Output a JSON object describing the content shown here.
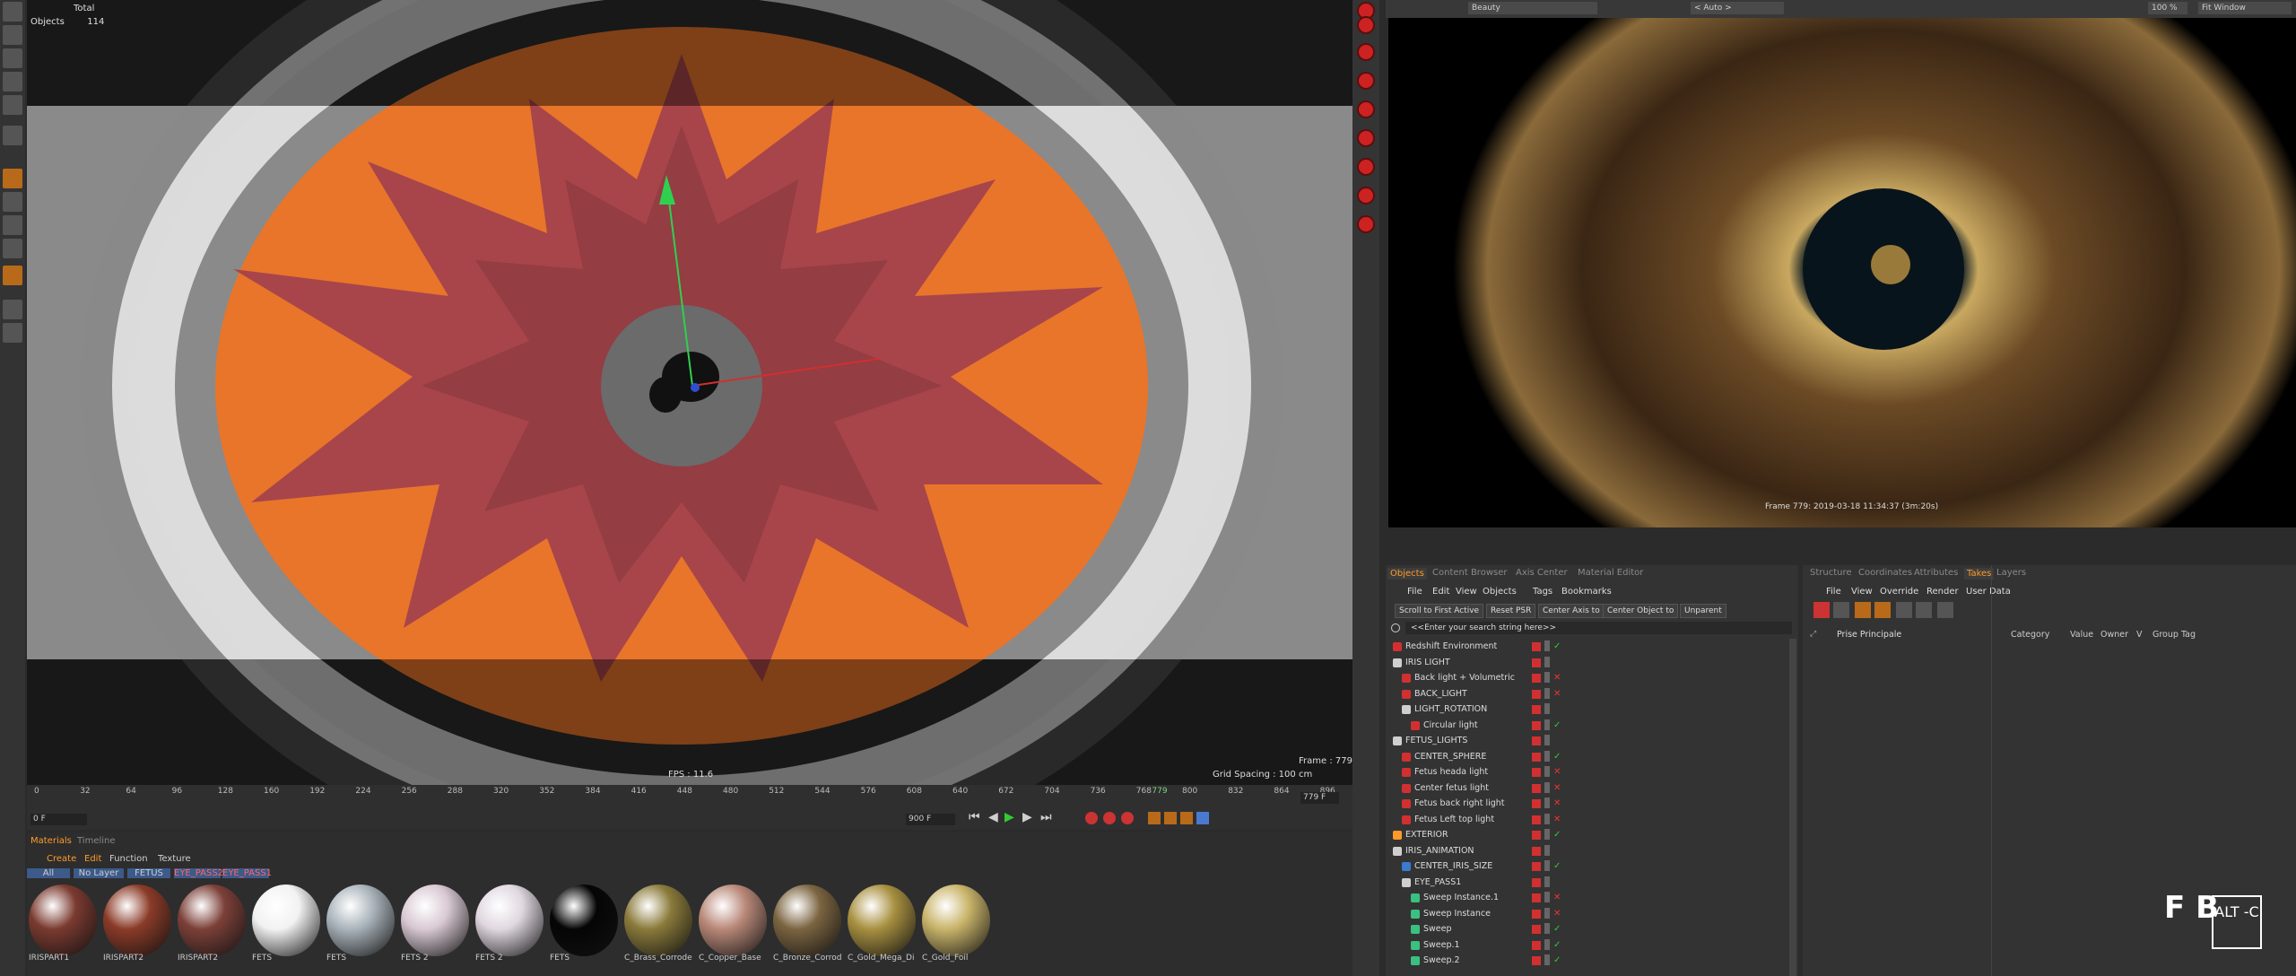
{
  "hud": {
    "total_label": "Total",
    "objects_label": "Objects",
    "objects_value": "114"
  },
  "viewport": {
    "fps": "FPS : 11.6",
    "grid": "Grid Spacing : 100 cm",
    "frame": "Frame : 779"
  },
  "timeline": {
    "ticks": [
      "0",
      "32",
      "64",
      "96",
      "128",
      "160",
      "192",
      "224",
      "256",
      "288",
      "320",
      "352",
      "384",
      "416",
      "448",
      "480",
      "512",
      "544",
      "576",
      "608",
      "640",
      "672",
      "704",
      "736",
      "768",
      "779",
      "800",
      "832",
      "864",
      "896"
    ],
    "start_field": "0 F",
    "end_field": "900 F",
    "current_field": "779 F"
  },
  "materials": {
    "tabs": [
      "Materials",
      "Timeline"
    ],
    "menu": [
      "Create",
      "Edit",
      "Function",
      "Texture"
    ],
    "filters": [
      "All",
      "No Layer",
      "FETUS",
      "EYE_PASS2",
      "EYE_PASS1"
    ],
    "items": [
      {
        "label": "IRISPART1",
        "color": "#7a3a30"
      },
      {
        "label": "IRISPART2",
        "color": "#8b3b28"
      },
      {
        "label": "IRISPART2",
        "color": "#7c4038"
      },
      {
        "label": "FETS",
        "color": "#f2f2f2"
      },
      {
        "label": "FETS",
        "color": "#aab4bb"
      },
      {
        "label": "FETS 2",
        "color": "#d9c9d3"
      },
      {
        "label": "FETS 2",
        "color": "#e0d8e0"
      },
      {
        "label": "FETS",
        "color": "#050505"
      },
      {
        "label": "C_Brass_Corrode",
        "color": "#8a7a3a"
      },
      {
        "label": "C_Copper_Base",
        "color": "#b88878"
      },
      {
        "label": "C_Bronze_Corrod",
        "color": "#7b6440"
      },
      {
        "label": "C_Gold_Mega_Di",
        "color": "#a89040"
      },
      {
        "label": "C_Gold_Foil",
        "color": "#c9b46a"
      }
    ]
  },
  "render_toolbar": {
    "mode": "Beauty",
    "camera": "< Auto >",
    "zoom": "100 %",
    "fit": "Fit Window"
  },
  "render_caption": "Frame  779:  2019-03-18  11:34:37  (3m:20s)",
  "objects_panel": {
    "tabs": [
      "Objects",
      "Content Browser",
      "Axis Center",
      "Material Editor"
    ],
    "menu": [
      "File",
      "Edit",
      "View",
      "Objects",
      "Tags",
      "Bookmarks"
    ],
    "buttons": [
      "Scroll to First Active",
      "Reset PSR",
      "Center Axis to",
      "Center Object to",
      "Unparent"
    ],
    "search": "<<Enter your search string here>>",
    "rows": [
      {
        "name": "Redshift Environment",
        "indent": 0,
        "color": "#d23030",
        "check": "✓"
      },
      {
        "name": "IRIS LIGHT",
        "indent": 0,
        "color": "#cfcfcf",
        "check": ""
      },
      {
        "name": "Back light + Volumetric",
        "indent": 1,
        "color": "#d23030",
        "check": "✕"
      },
      {
        "name": "BACK_LIGHT",
        "indent": 1,
        "color": "#d23030",
        "check": "✕"
      },
      {
        "name": "LIGHT_ROTATION",
        "indent": 1,
        "color": "#cfcfcf",
        "check": ""
      },
      {
        "name": "Circular light",
        "indent": 2,
        "color": "#d23030",
        "check": "✓"
      },
      {
        "name": "FETUS_LIGHTS",
        "indent": 0,
        "color": "#cfcfcf",
        "check": ""
      },
      {
        "name": "CENTER_SPHERE",
        "indent": 1,
        "color": "#d23030",
        "check": "✓"
      },
      {
        "name": "Fetus heada light",
        "indent": 1,
        "color": "#d23030",
        "check": "✕"
      },
      {
        "name": "Center fetus light",
        "indent": 1,
        "color": "#d23030",
        "check": "✕"
      },
      {
        "name": "Fetus back right light",
        "indent": 1,
        "color": "#d23030",
        "check": "✕"
      },
      {
        "name": "Fetus Left top light",
        "indent": 1,
        "color": "#d23030",
        "check": "✕"
      },
      {
        "name": "EXTERIOR",
        "indent": 0,
        "color": "#ff9a2a",
        "check": "✓"
      },
      {
        "name": "IRIS_ANIMATION",
        "indent": 0,
        "color": "#cfcfcf",
        "check": ""
      },
      {
        "name": "CENTER_IRIS_SIZE",
        "indent": 1,
        "color": "#3a7ad0",
        "check": "✓"
      },
      {
        "name": "EYE_PASS1",
        "indent": 1,
        "color": "#cfcfcf",
        "check": ""
      },
      {
        "name": "Sweep Instance.1",
        "indent": 2,
        "color": "#3ac080",
        "check": "✕"
      },
      {
        "name": "Sweep Instance",
        "indent": 2,
        "color": "#3ac080",
        "check": "✕"
      },
      {
        "name": "Sweep",
        "indent": 2,
        "color": "#3ac080",
        "check": "✓"
      },
      {
        "name": "Sweep.1",
        "indent": 2,
        "color": "#3ac080",
        "check": "✓"
      },
      {
        "name": "Sweep.2",
        "indent": 2,
        "color": "#3ac080",
        "check": "✓"
      }
    ]
  },
  "attributes_panel": {
    "tabs": [
      "Structure",
      "Coordinates",
      "Attributes",
      "Takes",
      "Layers"
    ],
    "menu": [
      "File",
      "View",
      "Override",
      "Render",
      "User Data"
    ],
    "take": "Prise Principale",
    "columns": [
      "Category",
      "Value",
      "Owner",
      "V",
      "Group Tag"
    ]
  },
  "branding": {
    "logo1": "F B",
    "logo2": "ALT -C"
  }
}
